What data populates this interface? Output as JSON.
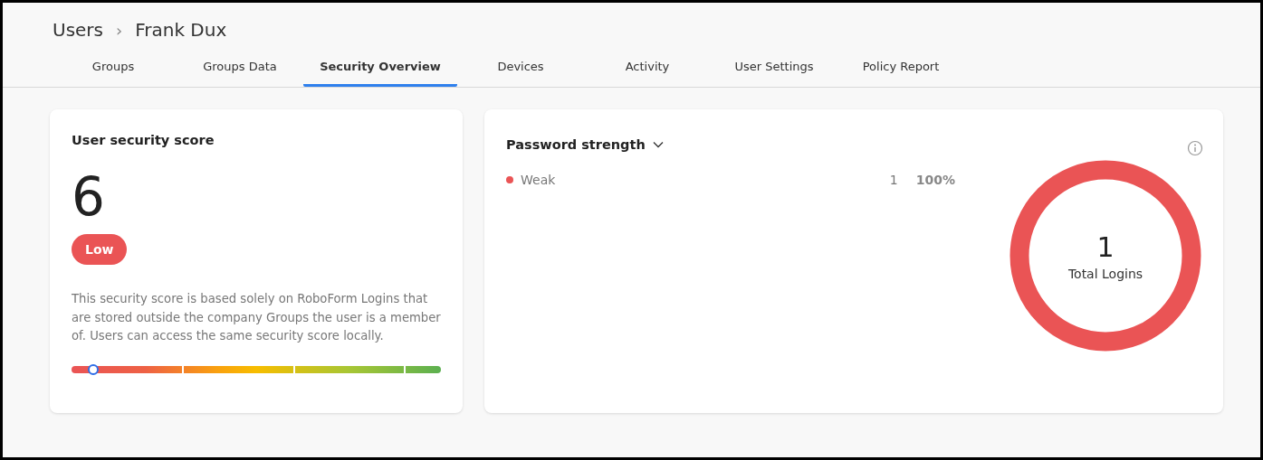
{
  "breadcrumb": {
    "parent": "Users",
    "separator": "›",
    "current": "Frank Dux"
  },
  "tabs": [
    {
      "label": "Groups",
      "selected": false
    },
    {
      "label": "Groups Data",
      "selected": false
    },
    {
      "label": "Security Overview",
      "selected": true
    },
    {
      "label": "Devices",
      "selected": false
    },
    {
      "label": "Activity",
      "selected": false
    },
    {
      "label": "User Settings",
      "selected": false
    },
    {
      "label": "Policy Report",
      "selected": false
    }
  ],
  "score_card": {
    "title": "User security score",
    "score": "6",
    "rating": "Low",
    "description": "This security score is based solely on RoboForm Logins that are stored outside the company Groups the user is a member of. Users can access the same security score locally.",
    "meter": {
      "level": 0.06
    }
  },
  "strength_card": {
    "title": "Password strength",
    "legend": [
      {
        "label": "Weak",
        "count": "1",
        "percent": "100%",
        "color": "#ea5455",
        "level": 1
      }
    ],
    "total": {
      "value": "1",
      "label": "Total Logins"
    }
  }
}
